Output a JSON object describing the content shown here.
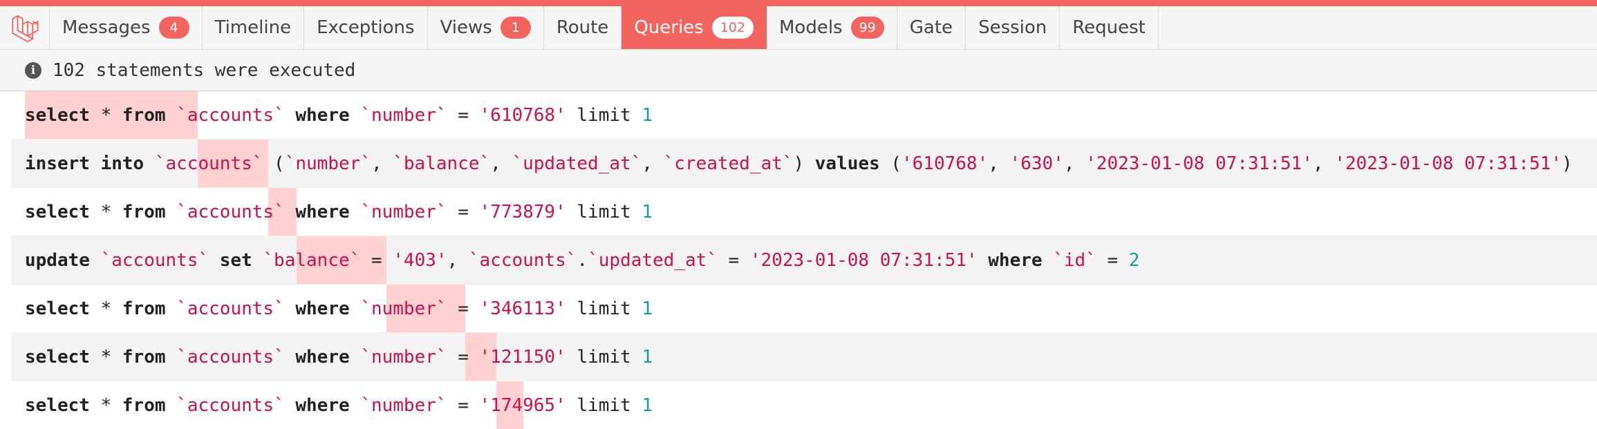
{
  "tabs": [
    {
      "label": "Messages",
      "badge": "4"
    },
    {
      "label": "Timeline",
      "badge": ""
    },
    {
      "label": "Exceptions",
      "badge": ""
    },
    {
      "label": "Views",
      "badge": "1"
    },
    {
      "label": "Route",
      "badge": ""
    },
    {
      "label": "Queries",
      "badge": "102",
      "active": true
    },
    {
      "label": "Models",
      "badge": "99"
    },
    {
      "label": "Gate",
      "badge": ""
    },
    {
      "label": "Session",
      "badge": ""
    },
    {
      "label": "Request",
      "badge": ""
    }
  ],
  "status": {
    "icon": "info-icon",
    "text": "102 statements were executed"
  },
  "colors": {
    "accent": "#f4645f",
    "identifier": "#d0104a",
    "number": "#1a9c96",
    "timebar": "#ffd1d1"
  },
  "queries": [
    {
      "timing_fraction": [
        0.0,
        0.11
      ],
      "tokens": [
        [
          "kw",
          "select"
        ],
        [
          "pn",
          " * "
        ],
        [
          "kw",
          "from"
        ],
        [
          "pn",
          " "
        ],
        [
          "id",
          "`accounts`"
        ],
        [
          "pn",
          " "
        ],
        [
          "kw",
          "where"
        ],
        [
          "pn",
          " "
        ],
        [
          "id",
          "`number`"
        ],
        [
          "pn",
          " = "
        ],
        [
          "str",
          "'610768'"
        ],
        [
          "pn",
          " "
        ],
        [
          "pn",
          "limit"
        ],
        [
          "pn",
          " "
        ],
        [
          "num",
          "1"
        ]
      ]
    },
    {
      "timing_fraction": [
        0.11,
        0.155
      ],
      "tokens": [
        [
          "kw",
          "insert into"
        ],
        [
          "pn",
          " "
        ],
        [
          "id",
          "`accounts`"
        ],
        [
          "pn",
          " ("
        ],
        [
          "id",
          "`number`"
        ],
        [
          "pn",
          ", "
        ],
        [
          "id",
          "`balance`"
        ],
        [
          "pn",
          ", "
        ],
        [
          "id",
          "`updated_at`"
        ],
        [
          "pn",
          ", "
        ],
        [
          "id",
          "`created_at`"
        ],
        [
          "pn",
          ") "
        ],
        [
          "kw",
          "values"
        ],
        [
          "pn",
          " ("
        ],
        [
          "str",
          "'610768'"
        ],
        [
          "pn",
          ", "
        ],
        [
          "str",
          "'630'"
        ],
        [
          "pn",
          ", "
        ],
        [
          "str",
          "'2023-01-08 07:31:51'"
        ],
        [
          "pn",
          ", "
        ],
        [
          "str",
          "'2023-01-08 07:31:51'"
        ],
        [
          "pn",
          ")"
        ]
      ]
    },
    {
      "timing_fraction": [
        0.155,
        0.173
      ],
      "tokens": [
        [
          "kw",
          "select"
        ],
        [
          "pn",
          " * "
        ],
        [
          "kw",
          "from"
        ],
        [
          "pn",
          " "
        ],
        [
          "id",
          "`accounts`"
        ],
        [
          "pn",
          " "
        ],
        [
          "kw",
          "where"
        ],
        [
          "pn",
          " "
        ],
        [
          "id",
          "`number`"
        ],
        [
          "pn",
          " = "
        ],
        [
          "str",
          "'773879'"
        ],
        [
          "pn",
          " "
        ],
        [
          "pn",
          "limit"
        ],
        [
          "pn",
          " "
        ],
        [
          "num",
          "1"
        ]
      ]
    },
    {
      "timing_fraction": [
        0.173,
        0.23
      ],
      "tokens": [
        [
          "kw",
          "update"
        ],
        [
          "pn",
          " "
        ],
        [
          "id",
          "`accounts`"
        ],
        [
          "pn",
          " "
        ],
        [
          "kw",
          "set"
        ],
        [
          "pn",
          " "
        ],
        [
          "id",
          "`balance`"
        ],
        [
          "pn",
          " = "
        ],
        [
          "str",
          "'403'"
        ],
        [
          "pn",
          ", "
        ],
        [
          "id",
          "`accounts`"
        ],
        [
          "pn",
          "."
        ],
        [
          "id",
          "`updated_at`"
        ],
        [
          "pn",
          " = "
        ],
        [
          "str",
          "'2023-01-08 07:31:51'"
        ],
        [
          "pn",
          " "
        ],
        [
          "kw",
          "where"
        ],
        [
          "pn",
          " "
        ],
        [
          "id",
          "`id`"
        ],
        [
          "pn",
          " = "
        ],
        [
          "num",
          "2"
        ]
      ]
    },
    {
      "timing_fraction": [
        0.23,
        0.28
      ],
      "tokens": [
        [
          "kw",
          "select"
        ],
        [
          "pn",
          " * "
        ],
        [
          "kw",
          "from"
        ],
        [
          "pn",
          " "
        ],
        [
          "id",
          "`accounts`"
        ],
        [
          "pn",
          " "
        ],
        [
          "kw",
          "where"
        ],
        [
          "pn",
          " "
        ],
        [
          "id",
          "`number`"
        ],
        [
          "pn",
          " = "
        ],
        [
          "str",
          "'346113'"
        ],
        [
          "pn",
          " "
        ],
        [
          "pn",
          "limit"
        ],
        [
          "pn",
          " "
        ],
        [
          "num",
          "1"
        ]
      ]
    },
    {
      "timing_fraction": [
        0.28,
        0.3
      ],
      "tokens": [
        [
          "kw",
          "select"
        ],
        [
          "pn",
          " * "
        ],
        [
          "kw",
          "from"
        ],
        [
          "pn",
          " "
        ],
        [
          "id",
          "`accounts`"
        ],
        [
          "pn",
          " "
        ],
        [
          "kw",
          "where"
        ],
        [
          "pn",
          " "
        ],
        [
          "id",
          "`number`"
        ],
        [
          "pn",
          " = "
        ],
        [
          "str",
          "'121150'"
        ],
        [
          "pn",
          " "
        ],
        [
          "pn",
          "limit"
        ],
        [
          "pn",
          " "
        ],
        [
          "num",
          "1"
        ]
      ]
    },
    {
      "timing_fraction": [
        0.3,
        0.317
      ],
      "tokens": [
        [
          "kw",
          "select"
        ],
        [
          "pn",
          " * "
        ],
        [
          "kw",
          "from"
        ],
        [
          "pn",
          " "
        ],
        [
          "id",
          "`accounts`"
        ],
        [
          "pn",
          " "
        ],
        [
          "kw",
          "where"
        ],
        [
          "pn",
          " "
        ],
        [
          "id",
          "`number`"
        ],
        [
          "pn",
          " = "
        ],
        [
          "str",
          "'174965'"
        ],
        [
          "pn",
          " "
        ],
        [
          "pn",
          "limit"
        ],
        [
          "pn",
          " "
        ],
        [
          "num",
          "1"
        ]
      ]
    }
  ]
}
